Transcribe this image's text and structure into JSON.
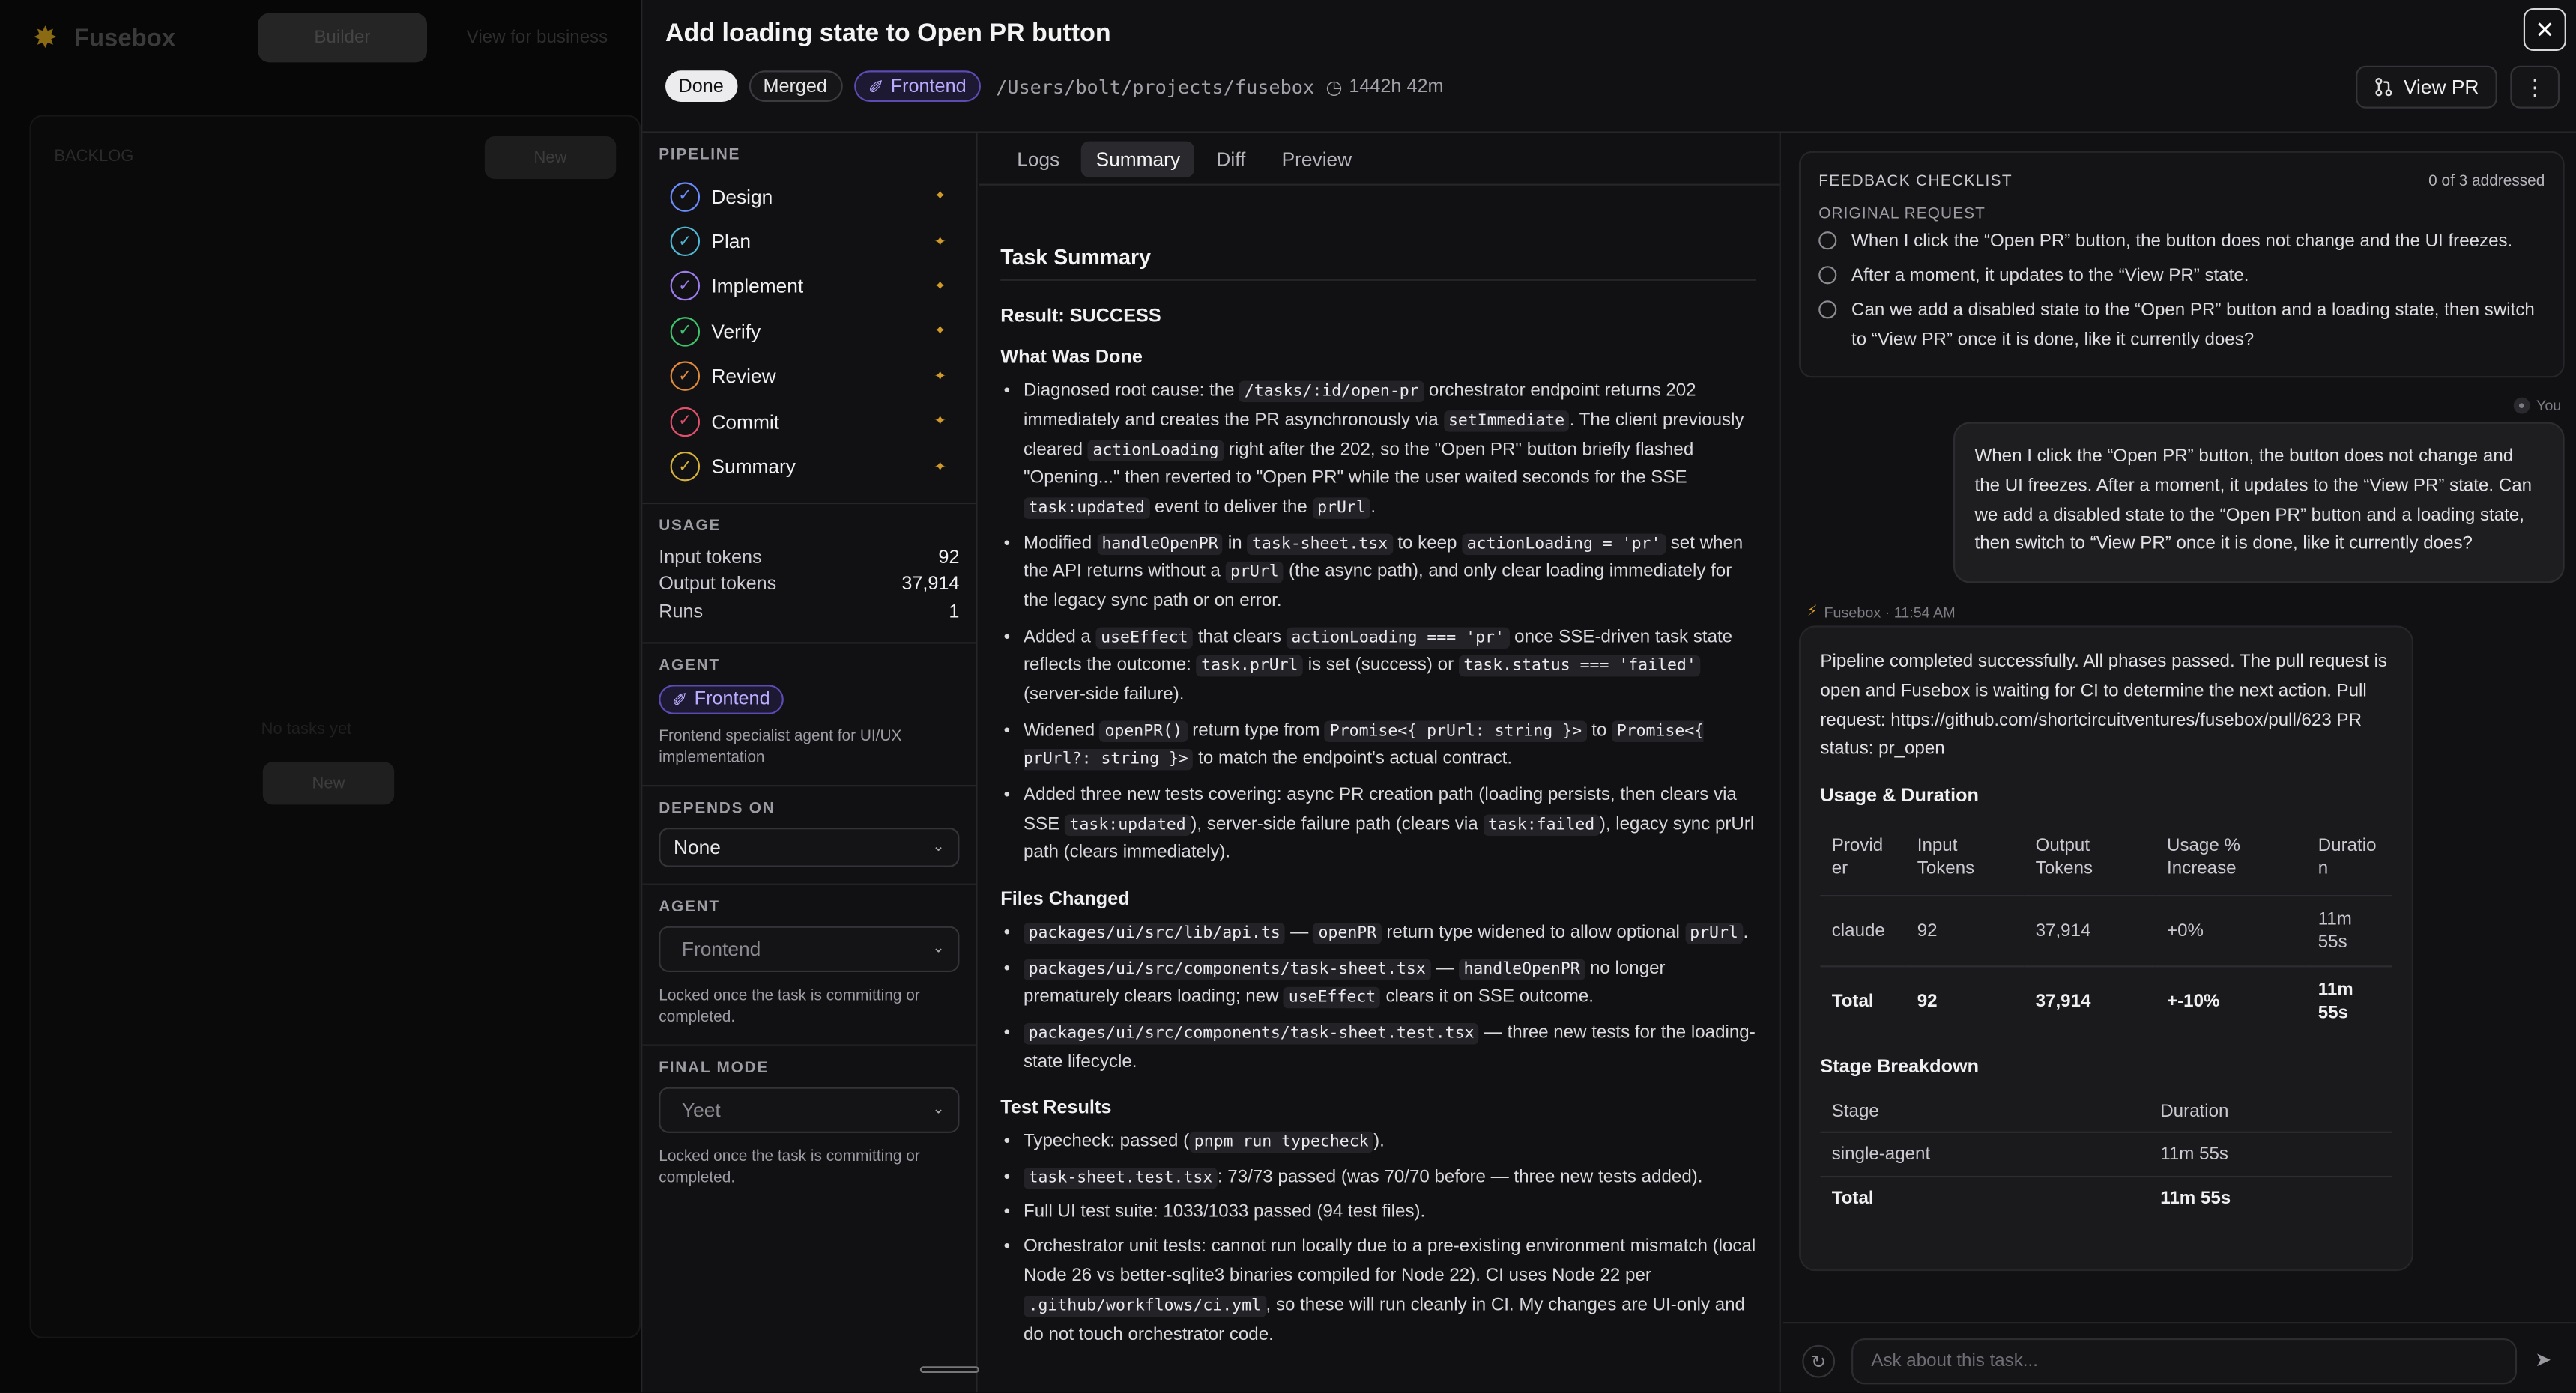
{
  "background_app": {
    "brand": "Fusebox",
    "top_button": "Builder",
    "top_link": "View for business",
    "board_title": "BACKLOG",
    "board_button": "New",
    "empty_text": "No tasks yet",
    "empty_button": "New"
  },
  "modal": {
    "title": "Add loading state to Open PR button",
    "status_badge": "Done",
    "merged_badge": "Merged",
    "agent_badge": "Frontend",
    "path": "/Users/bolt/projects/fusebox",
    "duration": "1442h 42m",
    "view_pr": "View PR",
    "close_icon": "close-icon",
    "more_icon": "more-vertical-icon"
  },
  "pipeline": {
    "heading": "PIPELINE",
    "stages": [
      {
        "label": "Design",
        "color": "#6b8cff"
      },
      {
        "label": "Plan",
        "color": "#4fb8d6"
      },
      {
        "label": "Implement",
        "color": "#9d7cf0"
      },
      {
        "label": "Verify",
        "color": "#3ec46d"
      },
      {
        "label": "Review",
        "color": "#e08a3c"
      },
      {
        "label": "Commit",
        "color": "#e0506a"
      },
      {
        "label": "Summary",
        "color": "#d4b23c"
      }
    ]
  },
  "usage": {
    "heading": "USAGE",
    "rows": [
      {
        "label": "Input tokens",
        "value": "92"
      },
      {
        "label": "Output tokens",
        "value": "37,914"
      },
      {
        "label": "Runs",
        "value": "1"
      }
    ]
  },
  "agent_info": {
    "heading": "AGENT",
    "badge": "Frontend",
    "description": "Frontend specialist agent for UI/UX implementation"
  },
  "depends_on": {
    "heading": "DEPENDS ON",
    "value": "None"
  },
  "agent_select": {
    "heading": "AGENT",
    "value": "Frontend",
    "note": "Locked once the task is committing or completed."
  },
  "final_mode": {
    "heading": "FINAL MODE",
    "value": "Yeet",
    "note": "Locked once the task is committing or completed."
  },
  "tabs": [
    "Logs",
    "Summary",
    "Diff",
    "Preview"
  ],
  "summary": {
    "title": "Task Summary",
    "result": "Result: SUCCESS",
    "what_heading": "What Was Done",
    "files_heading": "Files Changed",
    "tests_heading": "Test Results"
  },
  "feedback": {
    "heading": "FEEDBACK CHECKLIST",
    "count": "0 of 3 addressed",
    "sub": "ORIGINAL REQUEST",
    "items": [
      "When I click the “Open PR” button, the button does not change and the UI freezes.",
      "After a moment, it updates to the “View PR” state.",
      "Can we add a disabled state to the “Open PR” button and a loading state, then switch to “View PR” once it is done, like it currently does?"
    ]
  },
  "chat": {
    "you_label": "You",
    "user_message": "When I click the “Open PR” button, the button does not change and the UI freezes. After a moment, it updates to the “View PR” state. Can we add a disabled state to the “Open PR” button and a loading state, then switch to “View PR” once it is done, like it currently does?",
    "assistant_label": "Fusebox · 11:54 AM",
    "assistant_message": "Pipeline completed successfully. All phases passed. The pull request is open and Fusebox is waiting for CI to determine the next action. Pull request: https://github.com/shortcircuitventures/fusebox/pull/623 PR status: pr_open",
    "usage_heading": "Usage & Duration",
    "usage_headers": [
      "Provid er",
      "Input Tokens",
      "Output Tokens",
      "Usage % Increase",
      "Duratio n"
    ],
    "usage_rows": [
      [
        "claude",
        "92",
        "37,914",
        "+0%",
        "11m 55s"
      ],
      [
        "Total",
        "92",
        "37,914",
        "+-10%",
        "11m 55s"
      ]
    ],
    "stage_heading": "Stage Breakdown",
    "stage_headers": [
      "Stage",
      "Duration"
    ],
    "stage_rows": [
      [
        "single-agent",
        "11m 55s"
      ],
      [
        "Total",
        "11m 55s"
      ]
    ],
    "input_placeholder": "Ask about this task..."
  }
}
